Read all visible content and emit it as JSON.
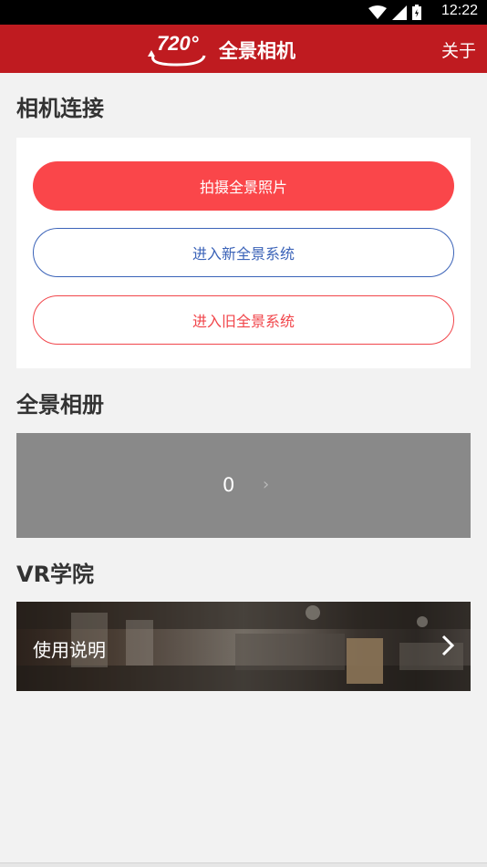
{
  "status_bar": {
    "time": "12:22",
    "icons": [
      "wifi-icon",
      "signal-icon",
      "battery-icon"
    ]
  },
  "app_bar": {
    "logo_text": "720°",
    "title": "全景相机",
    "about_label": "关于"
  },
  "sections": {
    "camera": {
      "title": "相机连接",
      "buttons": {
        "capture": "拍摄全景照片",
        "new_system": "进入新全景系统",
        "old_system": "进入旧全景系统"
      }
    },
    "album": {
      "title": "全景相册",
      "count": "0"
    },
    "vr": {
      "title": "VR学院",
      "item_label": "使用说明"
    }
  },
  "colors": {
    "app_bar": "#bf1b20",
    "primary_button": "#fa464a",
    "blue_outline": "#3b63b8",
    "red_outline": "#f1464b",
    "album_bg": "#898989"
  }
}
